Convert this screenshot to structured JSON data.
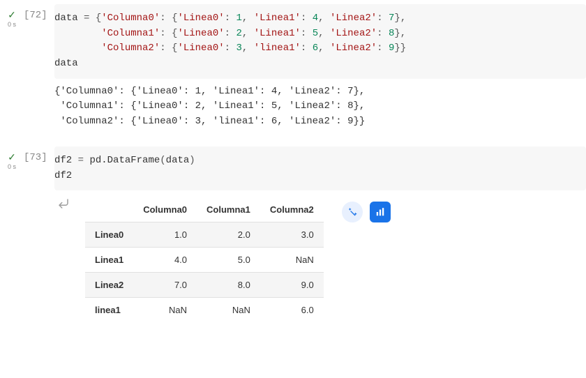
{
  "cells": {
    "cell72": {
      "status": "done",
      "exec_count": "[72]",
      "exec_time": "0 s",
      "code_tokens": {
        "l1_v1": "data",
        "l1_o1": " = ",
        "l1_p1": "{",
        "l1_s1": "'Columna0'",
        "l1_o2": ": ",
        "l1_p2": "{",
        "l1_s2": "'Linea0'",
        "l1_o3": ": ",
        "l1_n1": "1",
        "l1_o4": ", ",
        "l1_s3": "'Linea1'",
        "l1_o5": ": ",
        "l1_n2": "4",
        "l1_o6": ", ",
        "l1_s4": "'Linea2'",
        "l1_o7": ": ",
        "l1_n3": "7",
        "l1_p3": "}",
        "l1_o8": ",",
        "l2_s1": "'Columna1'",
        "l2_o1": ": ",
        "l2_p1": "{",
        "l2_s2": "'Linea0'",
        "l2_o2": ": ",
        "l2_n1": "2",
        "l2_o3": ", ",
        "l2_s3": "'Linea1'",
        "l2_o4": ": ",
        "l2_n2": "5",
        "l2_o5": ", ",
        "l2_s4": "'Linea2'",
        "l2_o6": ": ",
        "l2_n3": "8",
        "l2_p2": "}",
        "l2_o7": ",",
        "l3_s1": "'Columna2'",
        "l3_o1": ": ",
        "l3_p1": "{",
        "l3_s2": "'Linea0'",
        "l3_o2": ": ",
        "l3_n1": "3",
        "l3_o3": ", ",
        "l3_s3": "'linea1'",
        "l3_o4": ": ",
        "l3_n2": "6",
        "l3_o5": ", ",
        "l3_s4": "'Linea2'",
        "l3_o6": ": ",
        "l3_n3": "9",
        "l3_p2": "}}",
        "l4_v1": "data"
      },
      "output": "{'Columna0': {'Linea0': 1, 'Linea1': 4, 'Linea2': 7},\n 'Columna1': {'Linea0': 2, 'Linea1': 5, 'Linea2': 8},\n 'Columna2': {'Linea0': 3, 'linea1': 6, 'Linea2': 9}}"
    },
    "cell73": {
      "status": "done",
      "exec_count": "[73]",
      "exec_time": "0 s",
      "code_tokens": {
        "l1_v1": "df2",
        "l1_o1": " = ",
        "l1_v2": "pd.DataFrame",
        "l1_p1": "(",
        "l1_v3": "data",
        "l1_p2": ")",
        "l2_v1": "df2"
      },
      "output_icon": "⇢",
      "dataframe": {
        "columns": [
          "",
          "Columna0",
          "Columna1",
          "Columna2"
        ],
        "rows": [
          {
            "idx": "Linea0",
            "c0": "1.0",
            "c1": "2.0",
            "c2": "3.0"
          },
          {
            "idx": "Linea1",
            "c0": "4.0",
            "c1": "5.0",
            "c2": "NaN"
          },
          {
            "idx": "Linea2",
            "c0": "7.0",
            "c1": "8.0",
            "c2": "9.0"
          },
          {
            "idx": "linea1",
            "c0": "NaN",
            "c1": "NaN",
            "c2": "6.0"
          }
        ]
      }
    }
  },
  "icons": {
    "check": "✓",
    "magic": "✨",
    "chart": "▮"
  }
}
